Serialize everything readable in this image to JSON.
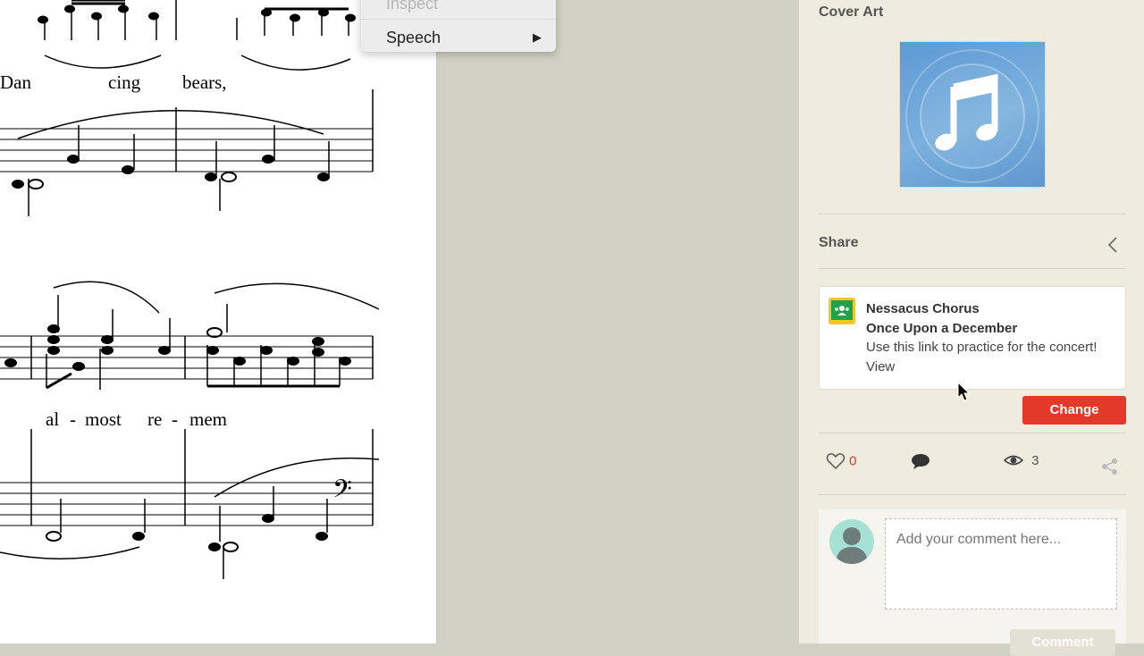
{
  "context_menu": {
    "inspect_label": "Inspect",
    "speech_label": "Speech",
    "submenu_arrow": "▶"
  },
  "score": {
    "lyrics_line1": [
      "Dan",
      "cing",
      "bears,"
    ],
    "lyrics_line2": [
      "al",
      "-",
      "most",
      "re",
      "-",
      "mem"
    ]
  },
  "sidebar": {
    "cover_art_title": "Cover Art",
    "share_title": "Share",
    "share_card": {
      "group": "Nessacus Chorus",
      "title": "Once Upon a December",
      "message": "Use this link to practice for the concert!",
      "view_label": "View",
      "app_icon": "google-classroom-icon"
    },
    "change_button": "Change",
    "stats": {
      "likes": "0",
      "views": "3"
    },
    "comment": {
      "placeholder": "Add your comment here...",
      "button": "Comment"
    }
  },
  "colors": {
    "accent_red": "#e2392a",
    "sidebar_bg": "#efebde",
    "gap_bg": "#d2d2c4",
    "cover_blue": "#6ba6d8"
  }
}
